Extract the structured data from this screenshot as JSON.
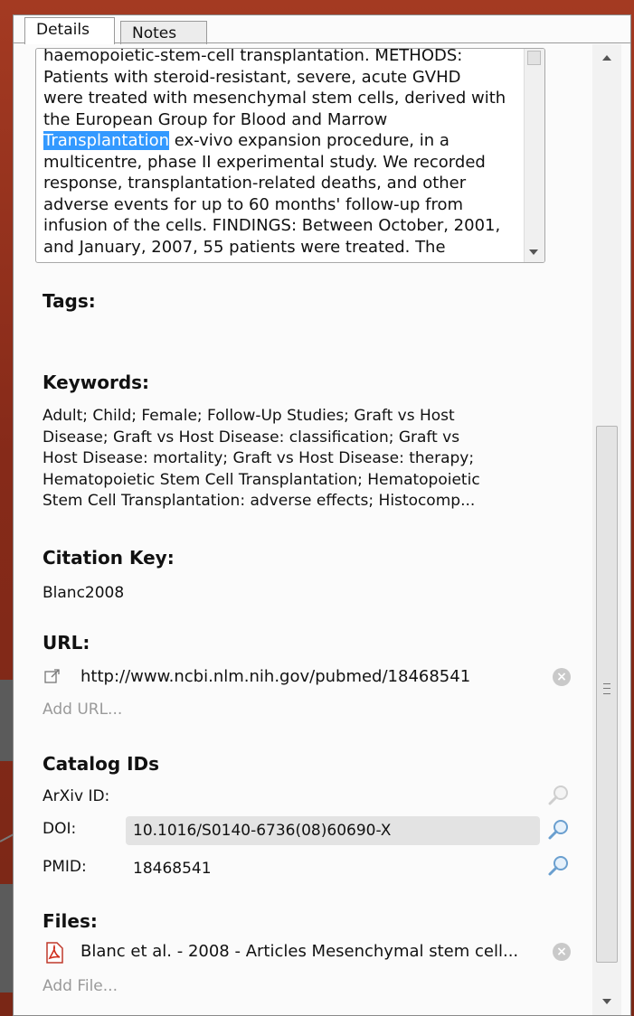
{
  "tabs": [
    {
      "label": "Details",
      "active": true
    },
    {
      "label": "Notes",
      "active": false
    }
  ],
  "abstract": {
    "line1": "haemopoietic-stem-cell transplantation. METHODS:",
    "line2": "Patients with steroid-resistant, severe, acute GVHD",
    "line3": "were treated with mesenchymal stem cells, derived with",
    "line4": "the European Group for Blood and Marrow",
    "line5_highlight": "Transplantation",
    "line5_rest": " ex-vivo expansion procedure, in a",
    "line6": "multicentre, phase II experimental study. We recorded",
    "line7": "response, transplantation-related deaths, and other",
    "line8": "adverse events for up to 60 months' follow-up from",
    "line9": "infusion of the cells. FINDINGS: Between October, 2001,",
    "line10": "and January, 2007, 55 patients were treated. The"
  },
  "tags": {
    "heading": "Tags:"
  },
  "keywords": {
    "heading": "Keywords:",
    "lines": [
      "Adult; Child; Female; Follow-Up Studies; Graft vs Host",
      "Disease; Graft vs Host Disease: classification; Graft vs",
      "Host Disease: mortality; Graft vs Host Disease: therapy;",
      "Hematopoietic Stem Cell Transplantation; Hematopoietic",
      "Stem Cell Transplantation: adverse effects; Histocomp..."
    ]
  },
  "citation": {
    "heading": "Citation Key:",
    "value": "Blanc2008"
  },
  "url": {
    "heading": "URL:",
    "value": "http://www.ncbi.nlm.nih.gov/pubmed/18468541",
    "add_label": "Add URL..."
  },
  "catalog": {
    "heading": "Catalog IDs",
    "arxiv_label": "ArXiv ID:",
    "doi_label": "DOI:",
    "doi_value": "10.1016/S0140-6736(08)60690-X",
    "pmid_label": "PMID:",
    "pmid_value": "18468541"
  },
  "files": {
    "heading": "Files:",
    "file_name": "Blanc et al. - 2008 - Articles Mesenchymal stem cell...",
    "add_label": "Add File..."
  },
  "colors": {
    "highlight": "#3399ff",
    "background": "#8f2f1c"
  }
}
